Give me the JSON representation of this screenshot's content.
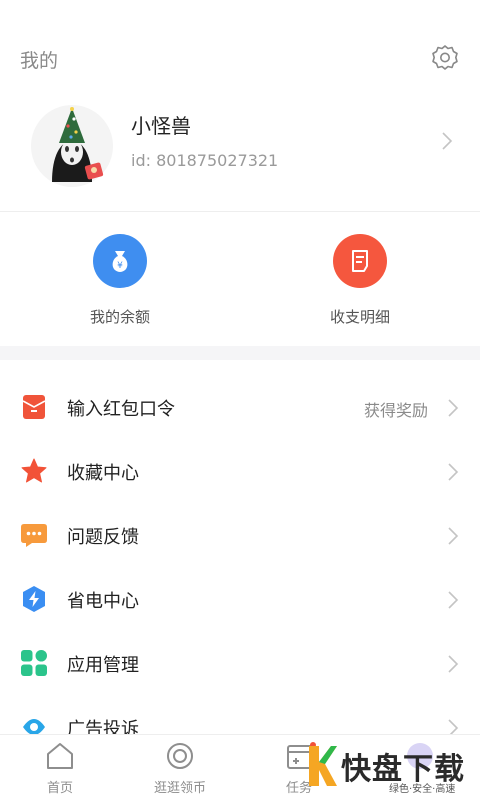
{
  "header": {
    "title": "我的",
    "settings_icon": "gear-icon"
  },
  "profile": {
    "username": "小怪兽",
    "user_id": "id: 801875027321",
    "avatar": "avatar-image"
  },
  "wallet": {
    "balance_label": "我的余额",
    "details_label": "收支明细",
    "balance_color": "#3f8ef0",
    "details_color": "#f5573e"
  },
  "menu": [
    {
      "label": "输入红包口令",
      "extra": "获得奖励",
      "icon": "red-envelope-icon"
    },
    {
      "label": "收藏中心",
      "icon": "star-icon"
    },
    {
      "label": "问题反馈",
      "icon": "chat-bubble-icon"
    },
    {
      "label": "省电中心",
      "icon": "lightning-icon"
    },
    {
      "label": "应用管理",
      "icon": "apps-grid-icon"
    },
    {
      "label": "广告投诉",
      "icon": "megaphone-icon"
    }
  ],
  "tabbar": [
    {
      "label": "首页",
      "icon": "home-icon"
    },
    {
      "label": "逛逛领币",
      "icon": "coin-icon"
    },
    {
      "label": "任务",
      "icon": "calendar-icon"
    },
    {
      "label": "",
      "icon": "profile-icon"
    }
  ],
  "watermark": {
    "brand": "快盘下载",
    "tagline": "绿色·安全·高速"
  }
}
